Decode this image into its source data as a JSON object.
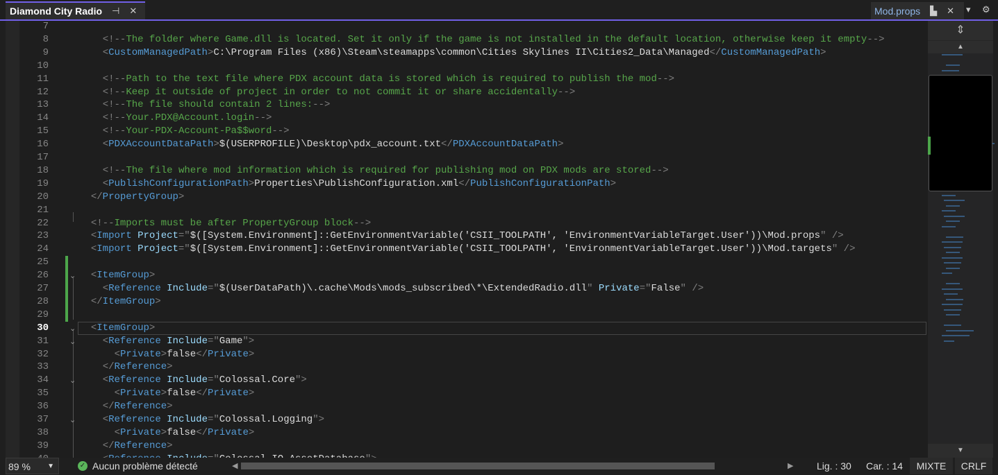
{
  "tabs": {
    "active": {
      "title": "Diamond City Radio",
      "pin_icon": "pin-icon",
      "close_icon": "close-icon"
    },
    "other": {
      "title": "Mod.props",
      "pin_icon": "pinned-icon",
      "close_icon": "close-icon"
    },
    "dropdown_icon": "chevron-down-icon",
    "settings_icon": "gear-icon"
  },
  "editor": {
    "current_line": 30,
    "changed_lines": [
      25,
      26,
      27,
      28,
      29
    ],
    "fold_lines": [
      26,
      30,
      31,
      34,
      37
    ],
    "lines": [
      {
        "n": "7",
        "i": 0,
        "tk": []
      },
      {
        "n": "8",
        "i": 4,
        "tk": [
          [
            "p",
            "<!--"
          ],
          [
            "c",
            "The folder where Game.dll is located. Set it only if the game is not installed in the default location, otherwise keep it empty"
          ],
          [
            "p",
            "-->"
          ]
        ]
      },
      {
        "n": "9",
        "i": 4,
        "tk": [
          [
            "p",
            "<"
          ],
          [
            "t",
            "CustomManagedPath"
          ],
          [
            "p",
            ">"
          ],
          [
            "v",
            "C:\\Program Files (x86)\\Steam\\steamapps\\common\\Cities Skylines II\\Cities2_Data\\Managed"
          ],
          [
            "p",
            "</"
          ],
          [
            "t",
            "CustomManagedPath"
          ],
          [
            "p",
            ">"
          ]
        ]
      },
      {
        "n": "10",
        "i": 0,
        "tk": []
      },
      {
        "n": "11",
        "i": 4,
        "tk": [
          [
            "p",
            "<!--"
          ],
          [
            "c",
            "Path to the text file where PDX account data is stored which is required to publish the mod"
          ],
          [
            "p",
            "-->"
          ]
        ]
      },
      {
        "n": "12",
        "i": 4,
        "tk": [
          [
            "p",
            "<!--"
          ],
          [
            "c",
            "Keep it outside of project in order to not commit it or share accidentally"
          ],
          [
            "p",
            "-->"
          ]
        ]
      },
      {
        "n": "13",
        "i": 4,
        "tk": [
          [
            "p",
            "<!--"
          ],
          [
            "c",
            "The file should contain 2 lines:"
          ],
          [
            "p",
            "-->"
          ]
        ]
      },
      {
        "n": "14",
        "i": 4,
        "tk": [
          [
            "p",
            "<!--"
          ],
          [
            "c",
            "Your.PDX@Account.login"
          ],
          [
            "p",
            "-->"
          ]
        ]
      },
      {
        "n": "15",
        "i": 4,
        "tk": [
          [
            "p",
            "<!--"
          ],
          [
            "c",
            "Your-PDX-Account-Pa$$word"
          ],
          [
            "p",
            "-->"
          ]
        ]
      },
      {
        "n": "16",
        "i": 4,
        "tk": [
          [
            "p",
            "<"
          ],
          [
            "t",
            "PDXAccountDataPath"
          ],
          [
            "p",
            ">"
          ],
          [
            "v",
            "$(USERPROFILE)\\Desktop\\pdx_account.txt"
          ],
          [
            "p",
            "</"
          ],
          [
            "t",
            "PDXAccountDataPath"
          ],
          [
            "p",
            ">"
          ]
        ]
      },
      {
        "n": "17",
        "i": 0,
        "tk": []
      },
      {
        "n": "18",
        "i": 4,
        "tk": [
          [
            "p",
            "<!--"
          ],
          [
            "c",
            "The file where mod information which is required for publishing mod on PDX mods are stored"
          ],
          [
            "p",
            "-->"
          ]
        ]
      },
      {
        "n": "19",
        "i": 4,
        "tk": [
          [
            "p",
            "<"
          ],
          [
            "t",
            "PublishConfigurationPath"
          ],
          [
            "p",
            ">"
          ],
          [
            "v",
            "Properties\\PublishConfiguration.xml"
          ],
          [
            "p",
            "</"
          ],
          [
            "t",
            "PublishConfigurationPath"
          ],
          [
            "p",
            ">"
          ]
        ]
      },
      {
        "n": "20",
        "i": 2,
        "tk": [
          [
            "p",
            "</"
          ],
          [
            "t",
            "PropertyGroup"
          ],
          [
            "p",
            ">"
          ]
        ]
      },
      {
        "n": "21",
        "i": 0,
        "tk": []
      },
      {
        "n": "22",
        "i": 2,
        "tk": [
          [
            "p",
            "<!--"
          ],
          [
            "c",
            "Imports must be after PropertyGroup block"
          ],
          [
            "p",
            "-->"
          ]
        ]
      },
      {
        "n": "23",
        "i": 2,
        "tk": [
          [
            "p",
            "<"
          ],
          [
            "t",
            "Import"
          ],
          [
            "v",
            " "
          ],
          [
            "a",
            "Project"
          ],
          [
            "p",
            "=\""
          ],
          [
            "v",
            "$([System.Environment]::GetEnvironmentVariable('CSII_TOOLPATH', 'EnvironmentVariableTarget.User'))\\Mod.props"
          ],
          [
            "p",
            "\" />"
          ]
        ]
      },
      {
        "n": "24",
        "i": 2,
        "tk": [
          [
            "p",
            "<"
          ],
          [
            "t",
            "Import"
          ],
          [
            "v",
            " "
          ],
          [
            "a",
            "Project"
          ],
          [
            "p",
            "=\""
          ],
          [
            "v",
            "$([System.Environment]::GetEnvironmentVariable('CSII_TOOLPATH', 'EnvironmentVariableTarget.User'))\\Mod.targets"
          ],
          [
            "p",
            "\" />"
          ]
        ]
      },
      {
        "n": "25",
        "i": 0,
        "tk": []
      },
      {
        "n": "26",
        "i": 2,
        "tk": [
          [
            "p",
            "<"
          ],
          [
            "t",
            "ItemGroup"
          ],
          [
            "p",
            ">"
          ]
        ]
      },
      {
        "n": "27",
        "i": 4,
        "tk": [
          [
            "p",
            "<"
          ],
          [
            "t",
            "Reference"
          ],
          [
            "v",
            " "
          ],
          [
            "a",
            "Include"
          ],
          [
            "p",
            "=\""
          ],
          [
            "v",
            "$(UserDataPath)\\.cache\\Mods\\mods_subscribed\\*\\ExtendedRadio.dll"
          ],
          [
            "p",
            "\" "
          ],
          [
            "a",
            "Private"
          ],
          [
            "p",
            "=\""
          ],
          [
            "v",
            "False"
          ],
          [
            "p",
            "\" />"
          ]
        ]
      },
      {
        "n": "28",
        "i": 2,
        "tk": [
          [
            "p",
            "</"
          ],
          [
            "t",
            "ItemGroup"
          ],
          [
            "p",
            ">"
          ]
        ]
      },
      {
        "n": "29",
        "i": 0,
        "tk": []
      },
      {
        "n": "30",
        "i": 2,
        "tk": [
          [
            "p",
            "<"
          ],
          [
            "t",
            "ItemGroup"
          ],
          [
            "p",
            ">"
          ]
        ]
      },
      {
        "n": "31",
        "i": 4,
        "tk": [
          [
            "p",
            "<"
          ],
          [
            "t",
            "Reference"
          ],
          [
            "v",
            " "
          ],
          [
            "a",
            "Include"
          ],
          [
            "p",
            "=\""
          ],
          [
            "v",
            "Game"
          ],
          [
            "p",
            "\">"
          ]
        ]
      },
      {
        "n": "32",
        "i": 6,
        "tk": [
          [
            "p",
            "<"
          ],
          [
            "t",
            "Private"
          ],
          [
            "p",
            ">"
          ],
          [
            "v",
            "false"
          ],
          [
            "p",
            "</"
          ],
          [
            "t",
            "Private"
          ],
          [
            "p",
            ">"
          ]
        ]
      },
      {
        "n": "33",
        "i": 4,
        "tk": [
          [
            "p",
            "</"
          ],
          [
            "t",
            "Reference"
          ],
          [
            "p",
            ">"
          ]
        ]
      },
      {
        "n": "34",
        "i": 4,
        "tk": [
          [
            "p",
            "<"
          ],
          [
            "t",
            "Reference"
          ],
          [
            "v",
            " "
          ],
          [
            "a",
            "Include"
          ],
          [
            "p",
            "=\""
          ],
          [
            "v",
            "Colossal.Core"
          ],
          [
            "p",
            "\">"
          ]
        ]
      },
      {
        "n": "35",
        "i": 6,
        "tk": [
          [
            "p",
            "<"
          ],
          [
            "t",
            "Private"
          ],
          [
            "p",
            ">"
          ],
          [
            "v",
            "false"
          ],
          [
            "p",
            "</"
          ],
          [
            "t",
            "Private"
          ],
          [
            "p",
            ">"
          ]
        ]
      },
      {
        "n": "36",
        "i": 4,
        "tk": [
          [
            "p",
            "</"
          ],
          [
            "t",
            "Reference"
          ],
          [
            "p",
            ">"
          ]
        ]
      },
      {
        "n": "37",
        "i": 4,
        "tk": [
          [
            "p",
            "<"
          ],
          [
            "t",
            "Reference"
          ],
          [
            "v",
            " "
          ],
          [
            "a",
            "Include"
          ],
          [
            "p",
            "=\""
          ],
          [
            "v",
            "Colossal.Logging"
          ],
          [
            "p",
            "\">"
          ]
        ]
      },
      {
        "n": "38",
        "i": 6,
        "tk": [
          [
            "p",
            "<"
          ],
          [
            "t",
            "Private"
          ],
          [
            "p",
            ">"
          ],
          [
            "v",
            "false"
          ],
          [
            "p",
            "</"
          ],
          [
            "t",
            "Private"
          ],
          [
            "p",
            ">"
          ]
        ]
      },
      {
        "n": "39",
        "i": 4,
        "tk": [
          [
            "p",
            "</"
          ],
          [
            "t",
            "Reference"
          ],
          [
            "p",
            ">"
          ]
        ]
      },
      {
        "n": "40",
        "i": 4,
        "tk": [
          [
            "p",
            "<"
          ],
          [
            "t",
            "Reference"
          ],
          [
            "v",
            " "
          ],
          [
            "a",
            "Include"
          ],
          [
            "p",
            "=\""
          ],
          [
            "v",
            "Colossal.IO.AssetDatabase"
          ],
          [
            "p",
            "\">"
          ]
        ]
      }
    ]
  },
  "minimap": {
    "split_icon": "split-editor-icon",
    "up_icon": "scroll-up-icon",
    "down_icon": "scroll-down-icon"
  },
  "status": {
    "zoom": "89 %",
    "issues": "Aucun problème détecté",
    "issues_icon": "check-circle-icon",
    "line": "Lig. : 30",
    "col": "Car. : 14",
    "encoding": "MIXTE",
    "eol": "CRLF"
  }
}
